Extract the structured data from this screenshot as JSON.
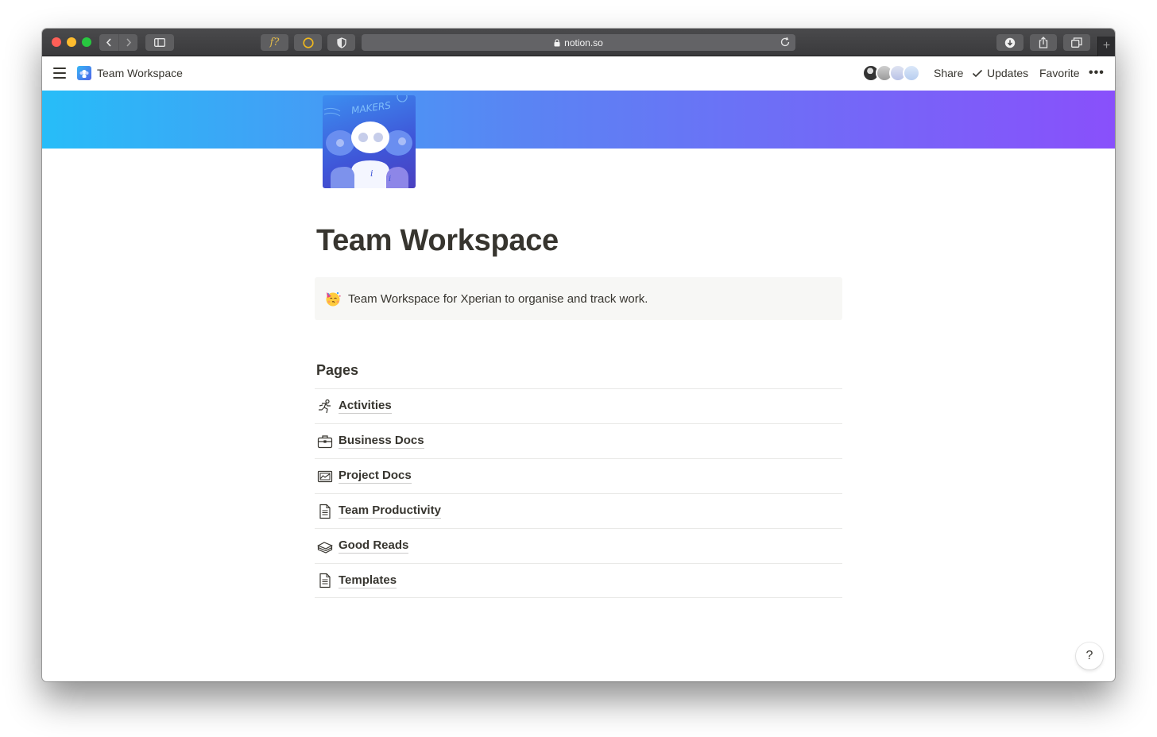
{
  "browser": {
    "url": "notion.so",
    "extension_label": "f?"
  },
  "topbar": {
    "breadcrumb": "Team Workspace",
    "share": "Share",
    "updates": "Updates",
    "favorite": "Favorite",
    "more": "•••"
  },
  "cover": {
    "icon_text": "MAKERS"
  },
  "page": {
    "title": "Team Workspace",
    "callout": "Team Workspace for Xperian to organise and track work.",
    "section_heading": "Pages",
    "pages": [
      {
        "label": "Activities",
        "icon": "running-figure-icon"
      },
      {
        "label": "Business Docs",
        "icon": "briefcase-icon"
      },
      {
        "label": "Project Docs",
        "icon": "chart-card-icon"
      },
      {
        "label": "Team Productivity",
        "icon": "document-icon"
      },
      {
        "label": "Good Reads",
        "icon": "books-icon"
      },
      {
        "label": "Templates",
        "icon": "document-icon"
      }
    ]
  },
  "help": "?",
  "colors": {
    "cover_start": "#27bdf8",
    "cover_end": "#8950fb",
    "text": "#37352f"
  }
}
